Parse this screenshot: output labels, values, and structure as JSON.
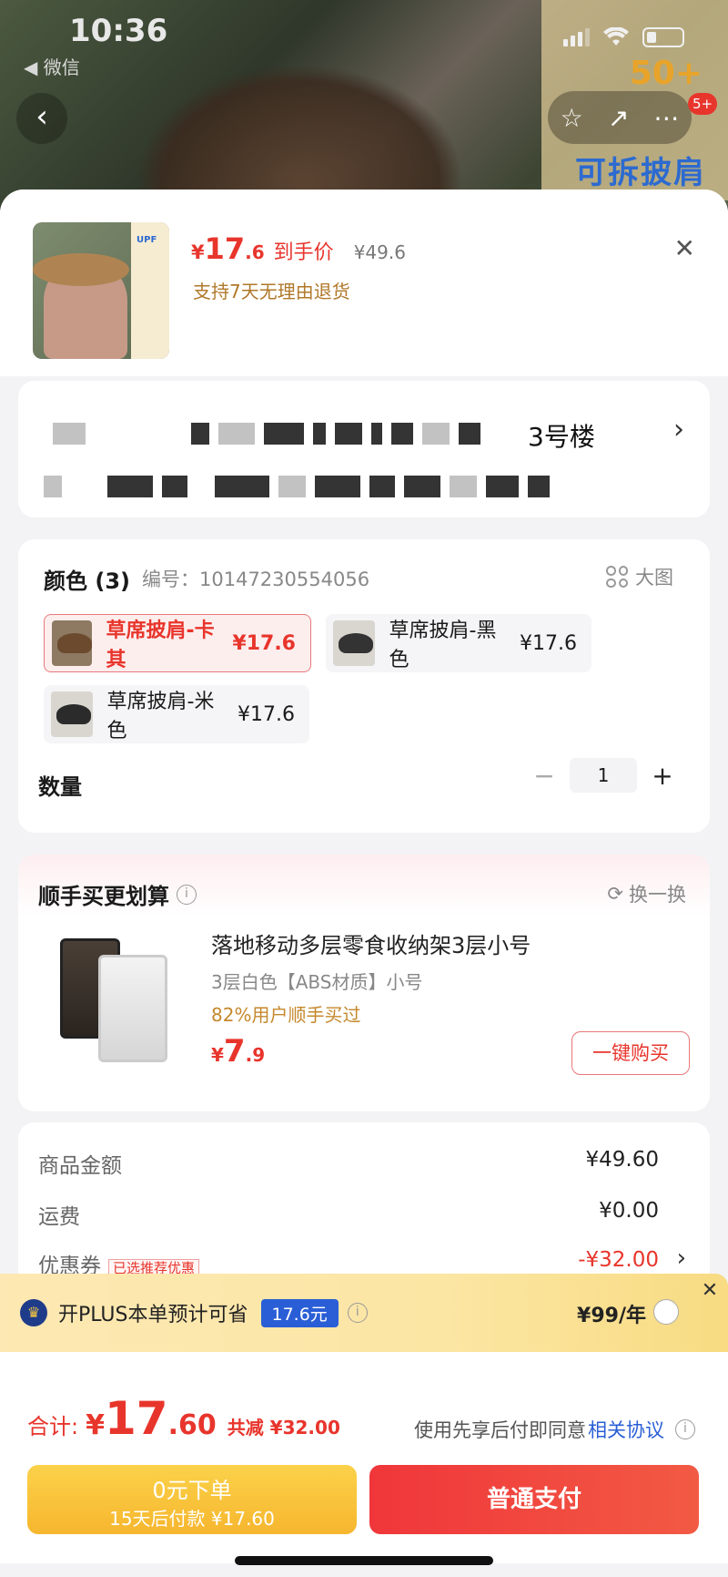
{
  "status": {
    "time": "10:36",
    "back_app": "◀ 微信"
  },
  "background": {
    "promo_upf": "50+",
    "promo_text": "可拆披肩",
    "notif_badge": "5+"
  },
  "product": {
    "price_symbol": "¥",
    "price_int": "17",
    "price_dec": ".6",
    "price_tag": "到手价",
    "orig_price": "¥49.6",
    "return_note": "支持7天无理由退货"
  },
  "address": {
    "tail": "3号楼"
  },
  "sku": {
    "title": "颜色 (3)",
    "code": "编号：10147230554056",
    "big_pic": "大图",
    "options": [
      {
        "label": "草席披肩-卡其",
        "price": "¥17.6"
      },
      {
        "label": "草席披肩-黑色",
        "price": "¥17.6"
      },
      {
        "label": "草席披肩-米色",
        "price": "¥17.6"
      }
    ],
    "qty_label": "数量",
    "qty_value": "1",
    "minus": "−",
    "plus": "+"
  },
  "addon": {
    "title": "顺手买更划算",
    "swap": "换一换",
    "name": "落地移动多层零食收纳架3层小号",
    "spec": "3层白色【ABS材质】小号",
    "bought": "82%用户顺手买过",
    "price_symbol": "¥",
    "price_int": "7",
    "price_dec": ".9",
    "buy_label": "一键购买"
  },
  "summary": {
    "goods_label": "商品金额",
    "goods_value": "¥49.60",
    "ship_label": "运费",
    "ship_value": "¥0.00",
    "coupon_label": "优惠券",
    "coupon_tag": "已选推荐优惠",
    "coupon_value": "-¥32.00"
  },
  "plus": {
    "text": "开PLUS本单预计可省",
    "badge": "17.6元",
    "price": "¥99/年"
  },
  "total": {
    "label": "合计:",
    "symbol": "¥",
    "int": "17",
    "dec": ".60",
    "save": "共减 ¥32.00",
    "agree_text": "使用先享后付即同意",
    "agree_link": "相关协议"
  },
  "buttons": {
    "zero_line1": "0元下单",
    "zero_line2": "15天后付款 ¥17.60",
    "pay": "普通支付"
  },
  "colors": {
    "accent_red": "#e8352c",
    "plus_blue": "#2a5ed6",
    "gold": "#f6b62e"
  }
}
